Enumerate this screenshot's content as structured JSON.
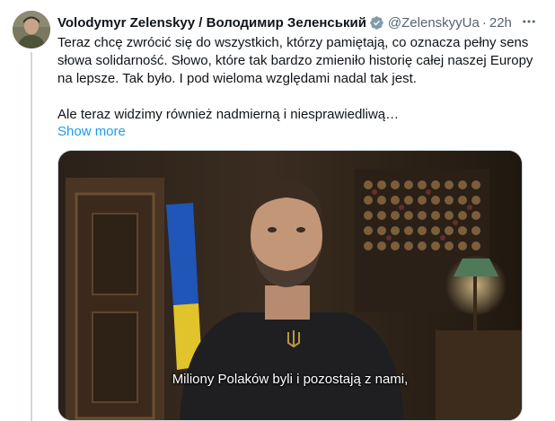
{
  "tweet": {
    "author_name": "Volodymyr Zelenskyy / Володимир Зеленський",
    "handle": "@ZelenskyyUa",
    "separator": "·",
    "time": "22h",
    "paragraph1": "Teraz chcę zwrócić się do wszystkich, którzy pamiętają, co oznacza pełny sens słowa solidarność. Słowo, które tak bardzo zmieniło historię całej naszej Europy na lepsze. Tak było. I pod wieloma względami nadal tak jest.",
    "paragraph2": "Ale teraz widzimy również nadmierną i niesprawiedliwą…",
    "show_more": "Show more",
    "video_subtitle": "Miliony Polaków byli i pozostają z nami,",
    "icons": {
      "verified": "verified-badge-icon",
      "more": "more-options-icon"
    },
    "colors": {
      "link": "#1d9bf0",
      "secondary_text": "#536471",
      "verified": "#829aab"
    }
  }
}
